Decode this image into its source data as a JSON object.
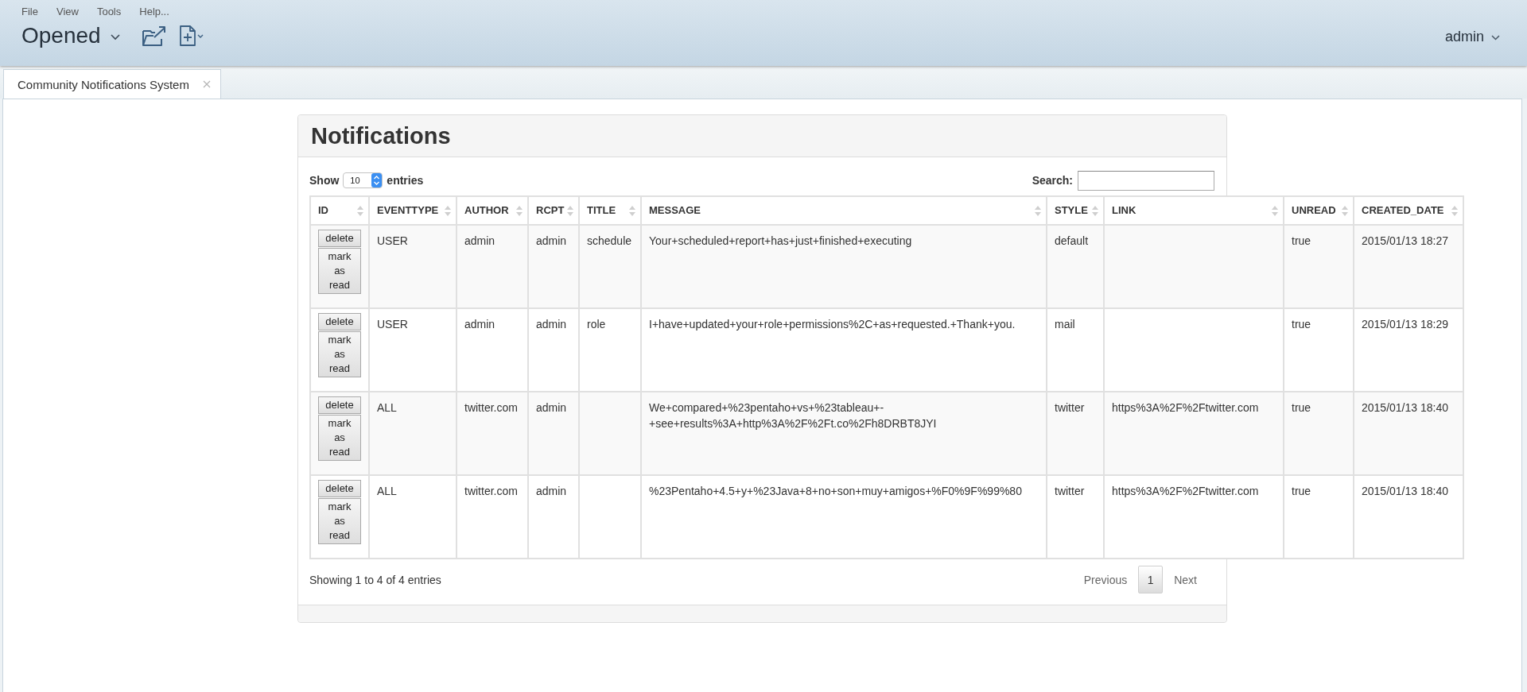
{
  "menu": [
    "File",
    "View",
    "Tools",
    "Help..."
  ],
  "toolbar": {
    "perspective": "Opened",
    "user": "admin"
  },
  "tabs": [
    {
      "label": "Community Notifications System",
      "selected": true
    }
  ],
  "panel": {
    "title": "Notifications",
    "length_menu": {
      "prefix": "Show",
      "value": "10",
      "suffix": "entries"
    },
    "search": {
      "label": "Search:"
    },
    "table": {
      "columns": [
        "ID",
        "EVENTTYPE",
        "AUTHOR",
        "RCPT",
        "TITLE",
        "MESSAGE",
        "STYLE",
        "LINK",
        "UNREAD",
        "CREATED_DATE"
      ],
      "rows": [
        {
          "actions": [
            "delete",
            "mark as read"
          ],
          "eventtype": "USER",
          "author": "admin",
          "rcpt": "admin",
          "title": "schedule",
          "message": "Your+scheduled+report+has+just+finished+executing",
          "style": "default",
          "unread": "true",
          "created_date": "2015/01/13 18:27"
        },
        {
          "actions": [
            "delete",
            "mark as read"
          ],
          "eventtype": "USER",
          "author": "admin",
          "rcpt": "admin",
          "title": "role",
          "message": "I+have+updated+your+role+permissions%2C+as+requested.+Thank+you.",
          "style": "mail",
          "unread": "true",
          "created_date": "2015/01/13 18:29"
        },
        {
          "actions": [
            "delete",
            "mark as read"
          ],
          "eventtype": "ALL",
          "author": "twitter.com",
          "rcpt": "admin",
          "message": "We+compared+%23pentaho+vs+%23tableau+-+see+results%3A+http%3A%2F%2Ft.co%2Fh8DRBT8JYI",
          "style": "twitter",
          "link": "https%3A%2F%2Ftwitter.com",
          "unread": "true",
          "created_date": "2015/01/13 18:40"
        },
        {
          "actions": [
            "delete",
            "mark as read"
          ],
          "eventtype": "ALL",
          "author": "twitter.com",
          "rcpt": "admin",
          "message": "%23Pentaho+4.5+y+%23Java+8+no+son+muy+amigos+%F0%9F%99%80",
          "style": "twitter",
          "link": "https%3A%2F%2Ftwitter.com",
          "unread": "true",
          "created_date": "2015/01/13 18:40"
        }
      ]
    },
    "info": "Showing 1 to 4 of 4 entries",
    "pagination": {
      "previous": {
        "label": "Previous",
        "disabled": true
      },
      "pages": [
        {
          "label": "1",
          "selected": true
        }
      ],
      "next": {
        "label": "Next",
        "disabled": true
      }
    }
  }
}
